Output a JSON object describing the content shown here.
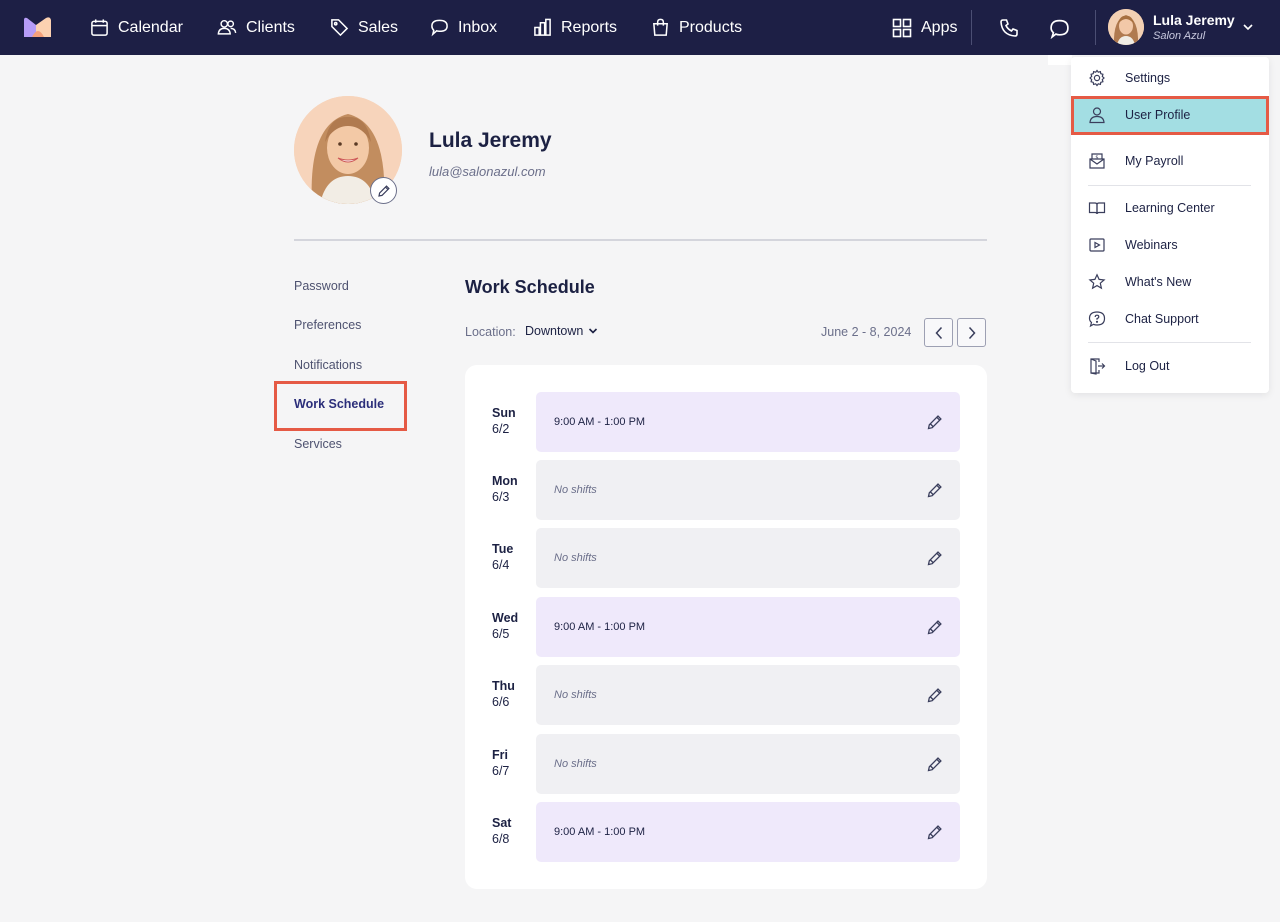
{
  "nav": {
    "items": [
      {
        "label": "Calendar",
        "icon": "calendar-icon"
      },
      {
        "label": "Clients",
        "icon": "users-icon"
      },
      {
        "label": "Sales",
        "icon": "tag-icon"
      },
      {
        "label": "Inbox",
        "icon": "chat-bubble-icon"
      },
      {
        "label": "Reports",
        "icon": "bar-chart-icon"
      },
      {
        "label": "Products",
        "icon": "shopping-bag-icon"
      }
    ],
    "apps_label": "Apps",
    "user_name": "Lula Jeremy",
    "user_org": "Salon Azul"
  },
  "profile": {
    "name": "Lula Jeremy",
    "email": "lula@salonazul.com"
  },
  "side_menu": {
    "items": [
      "Password",
      "Preferences",
      "Notifications",
      "Work Schedule",
      "Services"
    ],
    "active": "Work Schedule"
  },
  "schedule": {
    "title": "Work Schedule",
    "location_label": "Location:",
    "location_value": "Downtown",
    "date_range": "June 2 - 8, 2024",
    "days": [
      {
        "day": "Sun",
        "date": "6/2",
        "shift": "9:00 AM - 1:00 PM",
        "has_shift": true
      },
      {
        "day": "Mon",
        "date": "6/3",
        "shift": "No shifts",
        "has_shift": false
      },
      {
        "day": "Tue",
        "date": "6/4",
        "shift": "No shifts",
        "has_shift": false
      },
      {
        "day": "Wed",
        "date": "6/5",
        "shift": "9:00 AM - 1:00 PM",
        "has_shift": true
      },
      {
        "day": "Thu",
        "date": "6/6",
        "shift": "No shifts",
        "has_shift": false
      },
      {
        "day": "Fri",
        "date": "6/7",
        "shift": "No shifts",
        "has_shift": false
      },
      {
        "day": "Sat",
        "date": "6/8",
        "shift": "9:00 AM - 1:00 PM",
        "has_shift": true
      }
    ]
  },
  "user_menu": {
    "items": [
      {
        "label": "Settings",
        "icon": "gear-icon"
      },
      {
        "label": "User Profile",
        "icon": "user-icon",
        "selected": true
      },
      {
        "label": "My Payroll",
        "icon": "payroll-icon"
      },
      {
        "label": "Learning Center",
        "icon": "book-icon"
      },
      {
        "label": "Webinars",
        "icon": "video-icon"
      },
      {
        "label": "What's New",
        "icon": "star-icon"
      },
      {
        "label": "Chat Support",
        "icon": "question-bubble-icon"
      },
      {
        "label": "Log Out",
        "icon": "logout-icon"
      }
    ]
  },
  "colors": {
    "nav_bg": "#1d1f45",
    "highlight": "#e55a45",
    "shift_bg": "#efe9fb",
    "selected_menu_bg": "#a3dee3"
  }
}
